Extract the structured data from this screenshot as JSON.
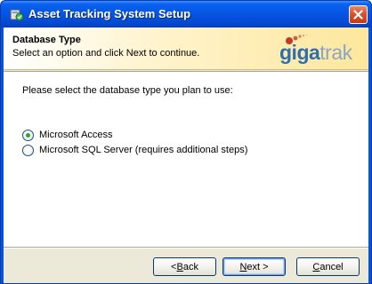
{
  "window": {
    "title": "Asset Tracking System Setup"
  },
  "header": {
    "title": "Database Type",
    "subtitle": "Select an option and click Next to continue.",
    "logo": {
      "part1": "giga",
      "part2": "trak",
      "colors": {
        "giga": "#2f6fb0",
        "trak": "#8aa6c4",
        "dots": "#c0392b"
      }
    }
  },
  "body": {
    "prompt": "Please select the database type you plan to use:",
    "options": [
      {
        "label": "Microsoft Access",
        "selected": true
      },
      {
        "label": "Microsoft SQL Server (requires additional steps)",
        "selected": false
      }
    ]
  },
  "buttons": {
    "back": {
      "pre": "< ",
      "mnemonic": "B",
      "post": "ack"
    },
    "next": {
      "pre": "",
      "mnemonic": "N",
      "post": "ext >"
    },
    "cancel": {
      "pre": "",
      "mnemonic": "C",
      "post": "ancel"
    }
  },
  "icons": {
    "app": "setup-icon",
    "close": "close-icon",
    "radio_selected": "radio-selected-icon",
    "radio_unselected": "radio-unselected-icon"
  },
  "colors": {
    "titlebar": "#0654e2",
    "close": "#c63a14",
    "header_gradient_end": "#fde79c",
    "radio_dot": "#2fa82f"
  }
}
